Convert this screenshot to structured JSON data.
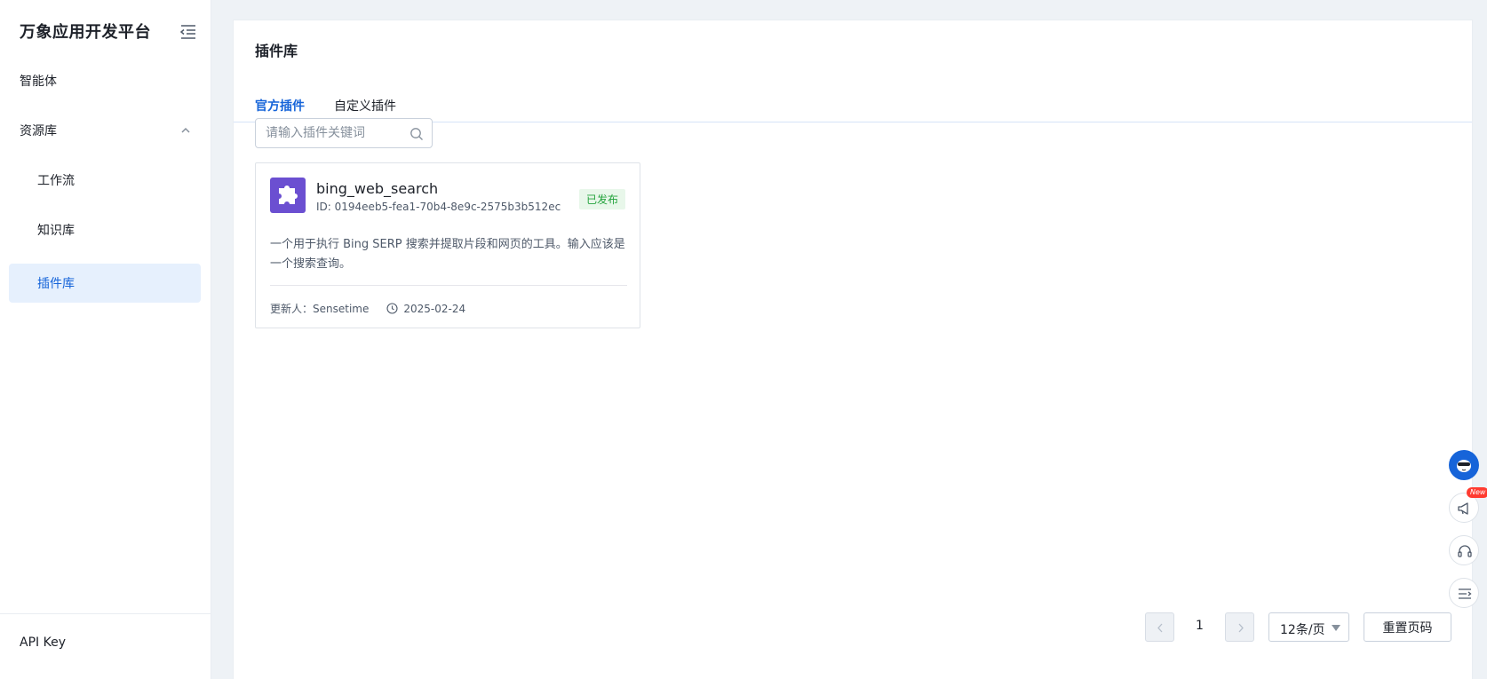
{
  "app": {
    "title": "万象应用开发平台"
  },
  "sidebar": {
    "items": [
      {
        "label": "智能体"
      },
      {
        "label": "资源库"
      },
      {
        "label": "工作流"
      },
      {
        "label": "知识库"
      },
      {
        "label": "插件库"
      }
    ],
    "footer_label": "API Key"
  },
  "main": {
    "title": "插件库",
    "tabs": [
      {
        "label": "官方插件",
        "active": true
      },
      {
        "label": "自定义插件",
        "active": false
      }
    ],
    "search": {
      "placeholder": "请输入插件关键词",
      "value": ""
    },
    "plugins": [
      {
        "name": "bing_web_search",
        "id": "ID: 0194eeb5-fea1-70b4-8e9c-2575b3b512ec",
        "status": "已发布",
        "description": "一个用于执行 Bing SERP 搜索并提取片段和网页的工具。输入应该是一个搜索查询。",
        "updater": "更新人：Sensetime",
        "date": "2025-02-24",
        "logo_color": "#6b4fd1",
        "logo_icon": "puzzle-icon"
      }
    ]
  },
  "pagination": {
    "current_page": "1",
    "page_size": "12条/页",
    "reset_label": "重置页码"
  },
  "floating": {
    "new_badge": "New",
    "icons": [
      "mascot-icon",
      "megaphone-icon",
      "headset-icon",
      "menu-icon"
    ]
  },
  "colors": {
    "accent": "#1664d9",
    "active_nav_bg": "#e6f0fd",
    "published_badge_bg": "#e8f7ea",
    "published_badge_text": "#23a33c",
    "plugin_logo": "#6b4fd1"
  }
}
